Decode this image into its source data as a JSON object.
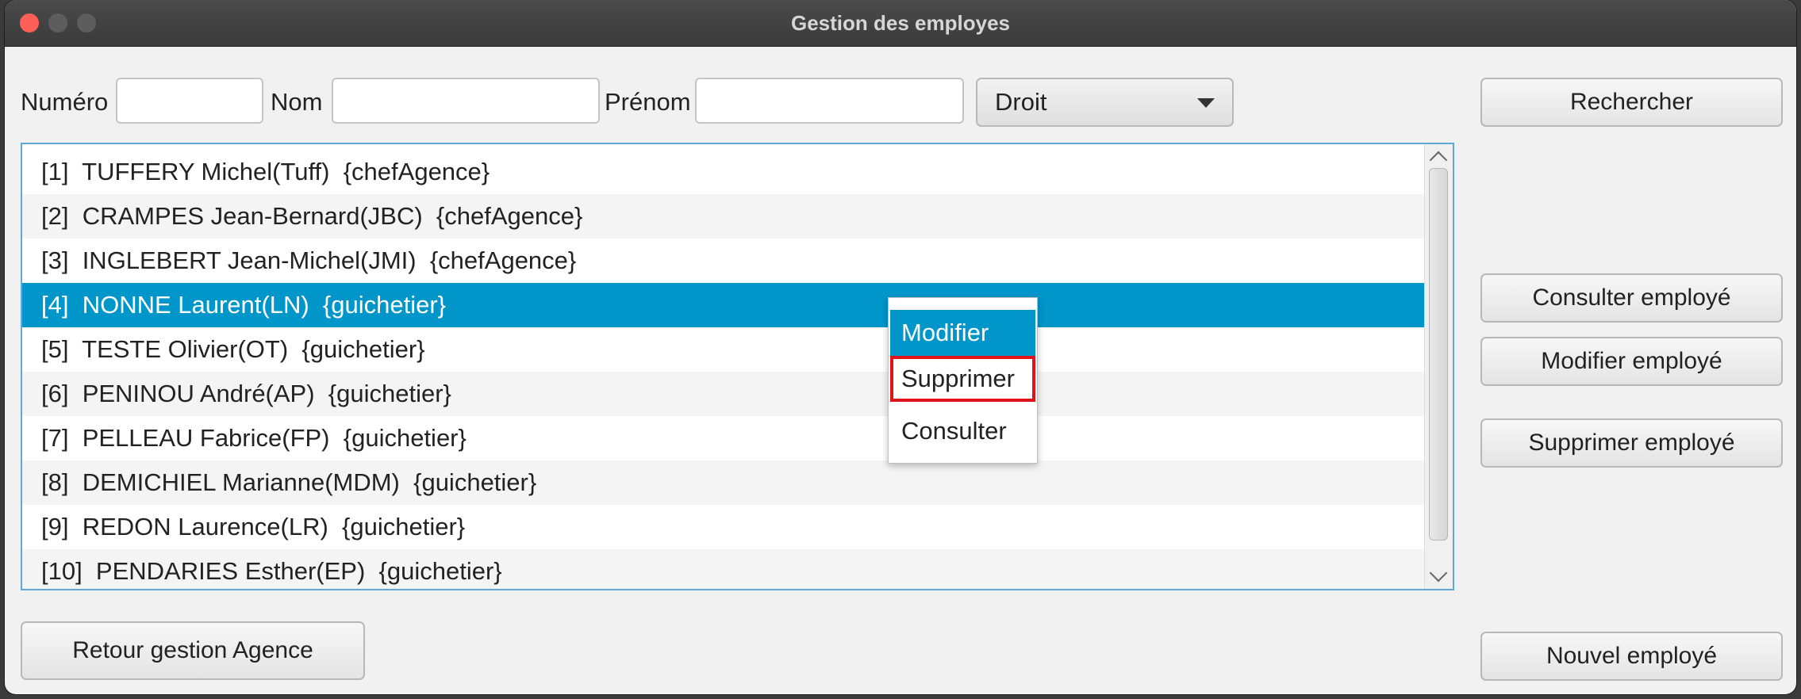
{
  "window": {
    "title": "Gestion des employes"
  },
  "search": {
    "numero_label": "Numéro",
    "numero_value": "",
    "nom_label": "Nom",
    "nom_value": "",
    "prenom_label": "Prénom",
    "prenom_value": "",
    "droit_selected": "Droit",
    "rechercher_label": "Rechercher"
  },
  "list": {
    "items": [
      "[1]  TUFFERY Michel(Tuff)  {chefAgence}",
      "[2]  CRAMPES Jean-Bernard(JBC)  {chefAgence}",
      "[3]  INGLEBERT Jean-Michel(JMI)  {chefAgence}",
      "[4]  NONNE Laurent(LN)  {guichetier}",
      "[5]  TESTE Olivier(OT)  {guichetier}",
      "[6]  PENINOU André(AP)  {guichetier}",
      "[7]  PELLEAU Fabrice(FP)  {guichetier}",
      "[8]  DEMICHIEL Marianne(MDM)  {guichetier}",
      "[9]  REDON Laurence(LR)  {guichetier}",
      "[10]  PENDARIES Esther(EP)  {guichetier}"
    ],
    "selected_index": 3
  },
  "context_menu": {
    "items": [
      "Modifier",
      "Supprimer",
      "Consulter"
    ]
  },
  "actions": {
    "consulter": "Consulter employé",
    "modifier": "Modifier employé",
    "supprimer": "Supprimer employé",
    "nouvel": "Nouvel employé",
    "retour": "Retour gestion Agence"
  },
  "colors": {
    "selection": "#0096c9",
    "highlight_box": "#e0131a",
    "close_button": "#fe5f57"
  }
}
